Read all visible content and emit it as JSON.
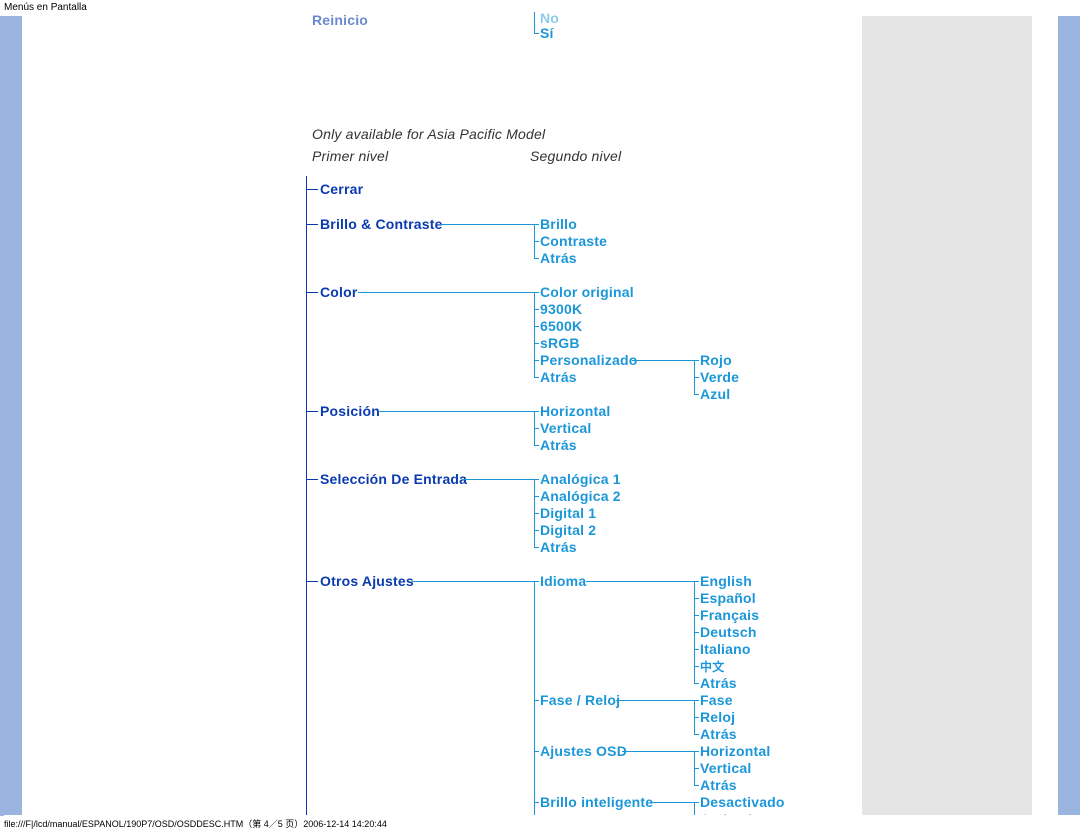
{
  "page_title": "Menús en Pantalla",
  "footer": "file:///F|/lcd/manual/ESPANOL/190P7/OSD/OSDDESC.HTM（第 4／5 页）2006-12-14 14:20:44",
  "header_note": "Only available for Asia Pacific Model",
  "col1_header": "Primer nivel",
  "col2_header": "Segundo nivel",
  "top_cut": {
    "left": "Reinicio",
    "right_top": "No",
    "right_bot": "Sí"
  },
  "level1": {
    "cerrar": "Cerrar",
    "brillo_contraste": "Brillo & Contraste",
    "color": "Color",
    "posicion": "Posición",
    "seleccion_entrada": "Selección De Entrada",
    "otros_ajustes": "Otros Ajustes"
  },
  "brillo_sub": {
    "brillo": "Brillo",
    "contraste": "Contraste",
    "atras": "Atrás"
  },
  "color_sub": {
    "color_original": "Color original",
    "k9300": "9300K",
    "k6500": "6500K",
    "srgb": "sRGB",
    "personalizado": "Personalizado",
    "atras": "Atrás"
  },
  "color_personalizado_sub": {
    "rojo": "Rojo",
    "verde": "Verde",
    "azul": "Azul"
  },
  "posicion_sub": {
    "horizontal": "Horizontal",
    "vertical": "Vertical",
    "atras": "Atrás"
  },
  "entrada_sub": {
    "analogica1": "Analógica 1",
    "analogica2": "Analógica  2",
    "digital1": "Digital  1",
    "digital2": "Digital  2",
    "atras": "Atrás"
  },
  "otros_sub": {
    "idioma": "Idioma",
    "fase_reloj": "Fase / Reloj",
    "ajustes_osd": "Ajustes OSD",
    "brillo_inteligente": "Brillo inteligente"
  },
  "idioma_sub": {
    "english": "English",
    "espanol": "Español",
    "francais": "Français",
    "deutsch": "Deutsch",
    "italiano": "Italiano",
    "chinese": "中文",
    "atras": "Atrás"
  },
  "fase_sub": {
    "fase": "Fase",
    "reloj": "Reloj",
    "atras": "Atrás"
  },
  "osd_sub": {
    "horizontal": "Horizontal",
    "vertical": "Vertical",
    "atras": "Atrás"
  },
  "brillo_int_sub": {
    "desactivado": "Desactivado",
    "activado": "Activado"
  }
}
